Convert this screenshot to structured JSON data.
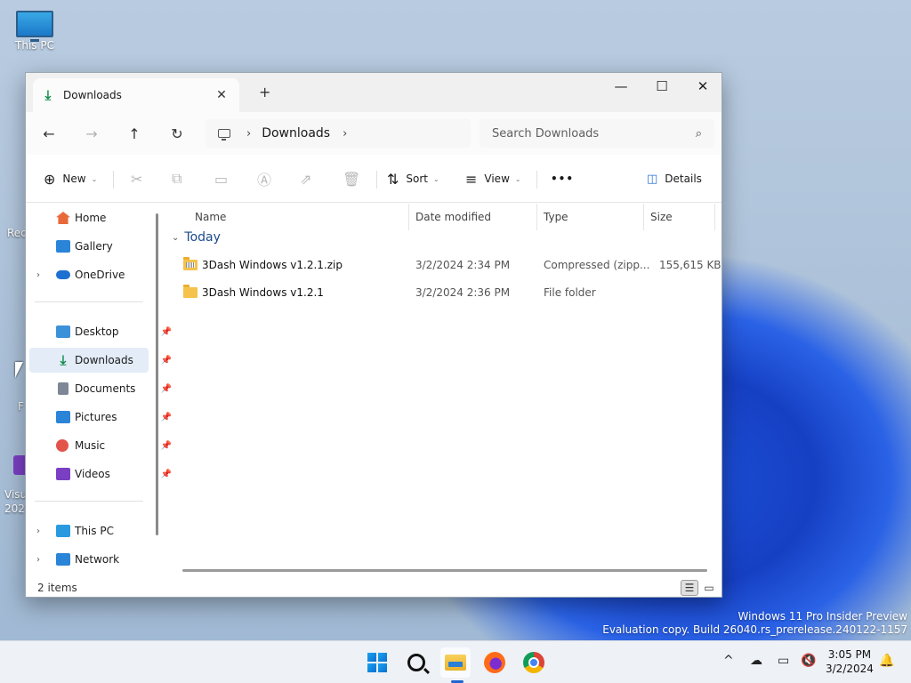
{
  "desktop": {
    "icons": [
      {
        "label": "This PC",
        "icon": "monitor-icon"
      },
      {
        "label": "Rec",
        "icon": "recycle-bin-icon"
      },
      {
        "label": "F",
        "icon": "shortcut-icon"
      },
      {
        "label": "Visu",
        "icon": "visual-studio-icon"
      },
      {
        "label": "202",
        "icon": ""
      }
    ],
    "watermark": {
      "line1": "Windows 11 Pro Insider Preview",
      "line2": "Evaluation copy. Build 26040.rs_prerelease.240122-1157"
    }
  },
  "window": {
    "tab": {
      "title": "Downloads",
      "icon": "download-icon",
      "close": "✕"
    },
    "new_tab": "+",
    "controls": {
      "minimize": "—",
      "maximize": "☐",
      "close": "✕"
    },
    "nav": {
      "back": "←",
      "forward": "→",
      "up": "↑",
      "refresh": "↻"
    },
    "address": {
      "crumb": "Downloads",
      "sep": "›"
    },
    "search": {
      "placeholder": "Search Downloads",
      "icon": "search-icon"
    },
    "commands": {
      "new": "New",
      "sort": "Sort",
      "view": "View",
      "more": "•••",
      "details": "Details"
    },
    "sidebar": {
      "top": [
        {
          "label": "Home",
          "icon": "home-icon",
          "color": "#e86a3a"
        },
        {
          "label": "Gallery",
          "icon": "gallery-icon",
          "color": "#2a84d8"
        },
        {
          "label": "OneDrive",
          "icon": "onedrive-icon",
          "color": "#1d6fd1"
        }
      ],
      "quick": [
        {
          "label": "Desktop",
          "icon": "desktop-icon",
          "color": "#3b92d9"
        },
        {
          "label": "Downloads",
          "icon": "download-icon",
          "color": "#0f8a4b"
        },
        {
          "label": "Documents",
          "icon": "documents-icon",
          "color": "#7d8796"
        },
        {
          "label": "Pictures",
          "icon": "pictures-icon",
          "color": "#2a84d8"
        },
        {
          "label": "Music",
          "icon": "music-icon",
          "color": "#e2534a"
        },
        {
          "label": "Videos",
          "icon": "videos-icon",
          "color": "#7b3fc4"
        }
      ],
      "bottom": [
        {
          "label": "This PC",
          "icon": "this-pc-icon",
          "color": "#2a9ae0"
        },
        {
          "label": "Network",
          "icon": "network-icon",
          "color": "#2a84d8"
        }
      ]
    },
    "columns": [
      "Name",
      "Date modified",
      "Type",
      "Size"
    ],
    "group": "Today",
    "files": [
      {
        "name": "3Dash Windows v1.2.1.zip",
        "date": "3/2/2024 2:34 PM",
        "type": "Compressed (zipp...",
        "size": "155,615 KB",
        "icon": "zip-folder-icon"
      },
      {
        "name": "3Dash Windows v1.2.1",
        "date": "3/2/2024 2:36 PM",
        "type": "File folder",
        "size": "",
        "icon": "folder-icon"
      }
    ],
    "status": "2 items"
  },
  "taskbar": {
    "apps": [
      "start-icon",
      "search-icon",
      "file-explorer-icon",
      "firefox-icon",
      "chrome-icon"
    ],
    "tray": {
      "chevron": "^",
      "time": "3:05 PM",
      "date": "3/2/2024"
    }
  }
}
